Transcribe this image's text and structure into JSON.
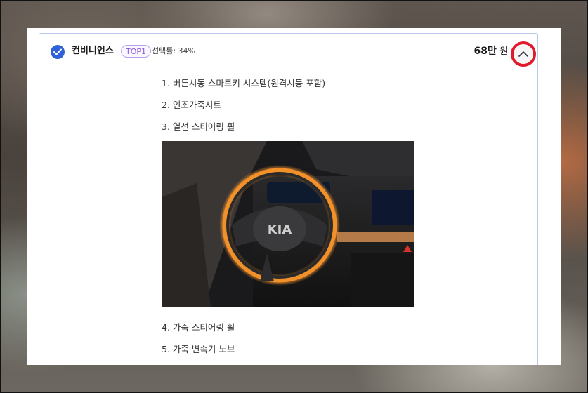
{
  "option": {
    "name": "컨비니언스",
    "badge": "TOP1",
    "selection_rate": "선택률: 34%",
    "price_number": "68만",
    "price_unit": "원",
    "toggle_icon": "chevron-up-icon"
  },
  "features": [
    "1. 버튼시동 스마트키 시스템(원격시동 포함)",
    "2. 인조가죽시트",
    "3. 열선 스티어링 휠",
    "4. 가죽 스티어링 휠",
    "5. 가죽 변속기 노브"
  ],
  "colors": {
    "accent_blue": "#2f62d8",
    "badge_purple": "#8a5de0",
    "highlight_red": "#e01a2a",
    "wheel_glow": "#f2902a"
  }
}
